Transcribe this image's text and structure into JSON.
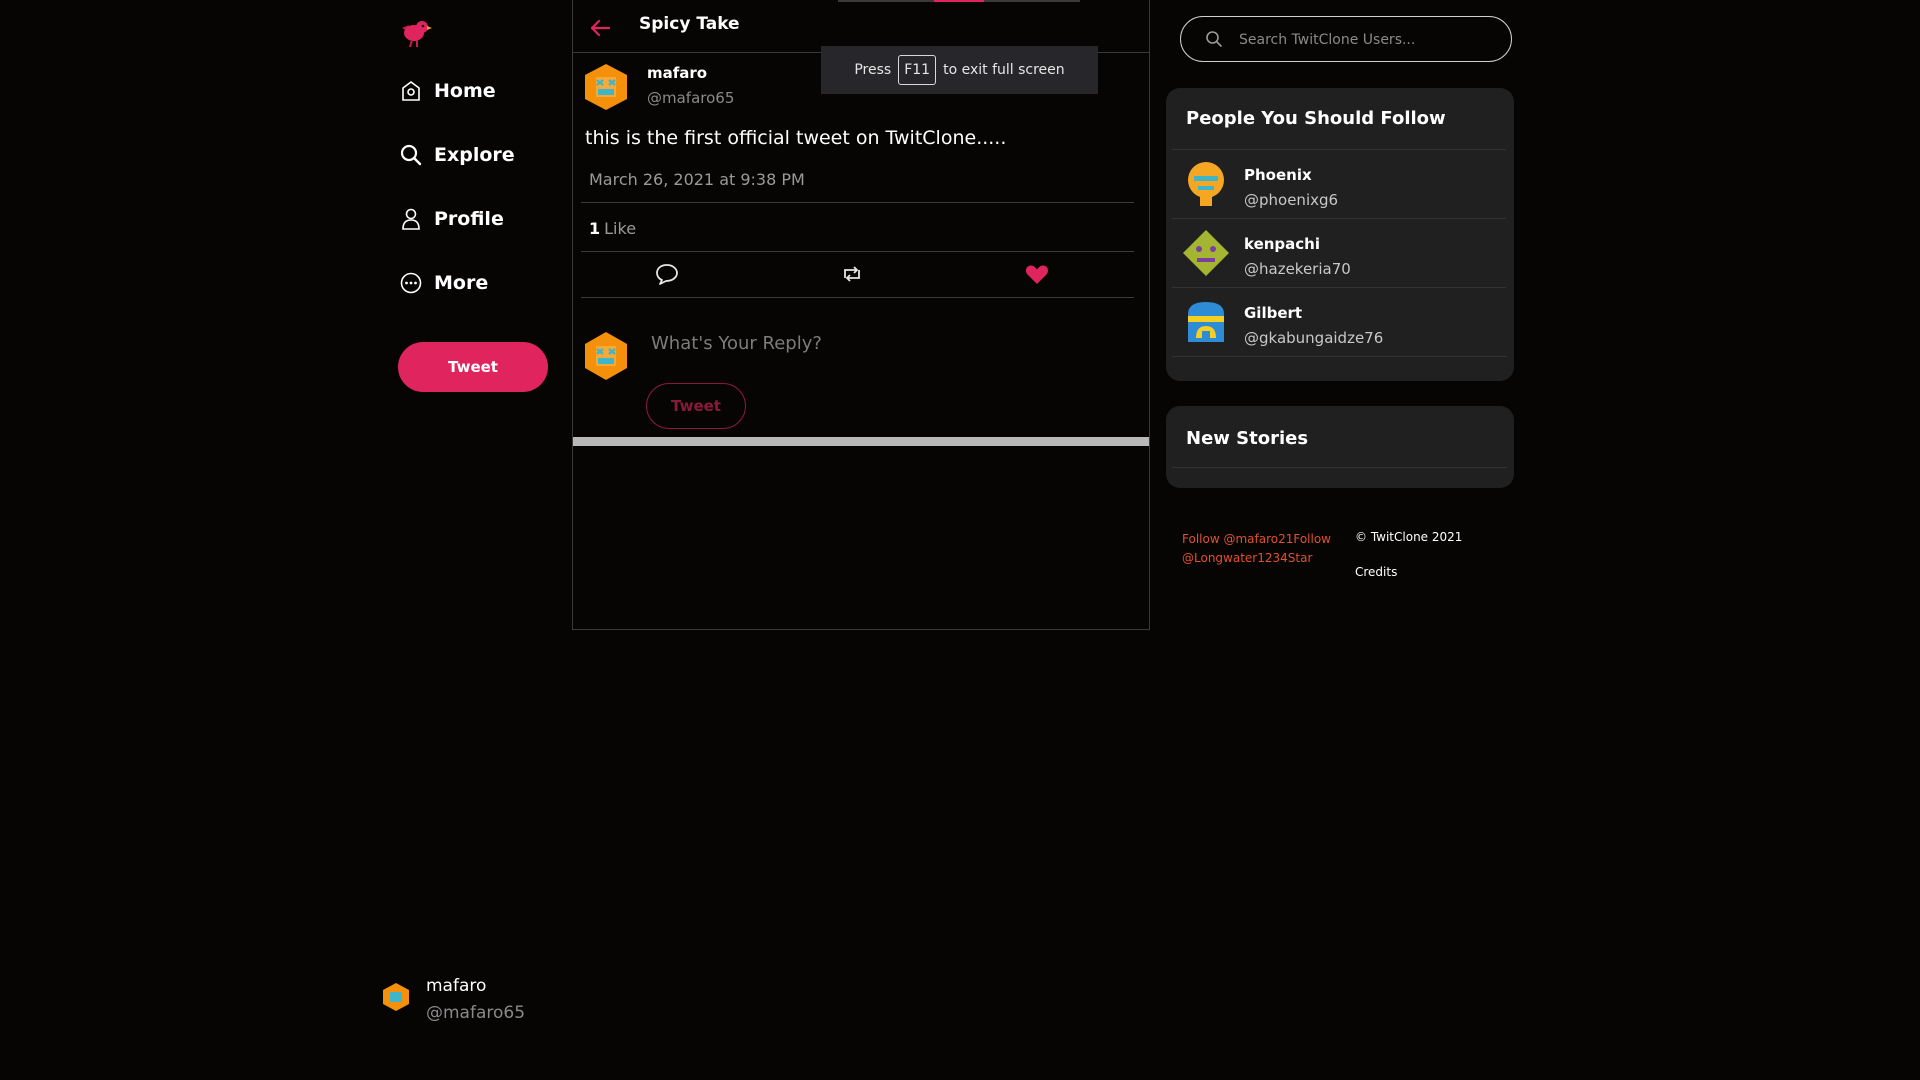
{
  "colors": {
    "accent": "#e0245e",
    "background": "#070404",
    "card": "#202020",
    "link_orange": "#e0512d"
  },
  "sidebar": {
    "logo_icon": "bird-icon",
    "nav": [
      {
        "label": "Home",
        "icon": "home-icon"
      },
      {
        "label": "Explore",
        "icon": "search-icon"
      },
      {
        "label": "Profile",
        "icon": "user-icon"
      },
      {
        "label": "More",
        "icon": "more-icon"
      }
    ],
    "tweet_button": "Tweet",
    "current_user": {
      "name": "mafaro",
      "handle": "@mafaro65"
    }
  },
  "header": {
    "title": "Spicy Take"
  },
  "tweet": {
    "author_name": "mafaro",
    "author_handle": "@mafaro65",
    "text": "this is the first official tweet on TwitClone.....",
    "date": "March 26, 2021 at 9:38 PM",
    "like_count": "1",
    "like_label": "Like",
    "liked": true
  },
  "reply": {
    "placeholder": "What's Your Reply?",
    "button": "Tweet"
  },
  "fullscreen_notice": {
    "prefix": "Press",
    "key": "F11",
    "suffix": "to exit full screen"
  },
  "search": {
    "placeholder": "Search TwitClone Users..."
  },
  "follow_panel": {
    "title": "People You Should Follow",
    "people": [
      {
        "name": "Phoenix",
        "handle": "@phoenixg6"
      },
      {
        "name": "kenpachi",
        "handle": "@hazekeria70"
      },
      {
        "name": "Gilbert",
        "handle": "@gkabungaidze76"
      }
    ]
  },
  "stories_panel": {
    "title": "New Stories"
  },
  "footer": {
    "follow_text": "Follow @mafaro21Follow @Longwater1234Star",
    "copyright": "© TwitClone 2021",
    "credits": "Credits"
  }
}
